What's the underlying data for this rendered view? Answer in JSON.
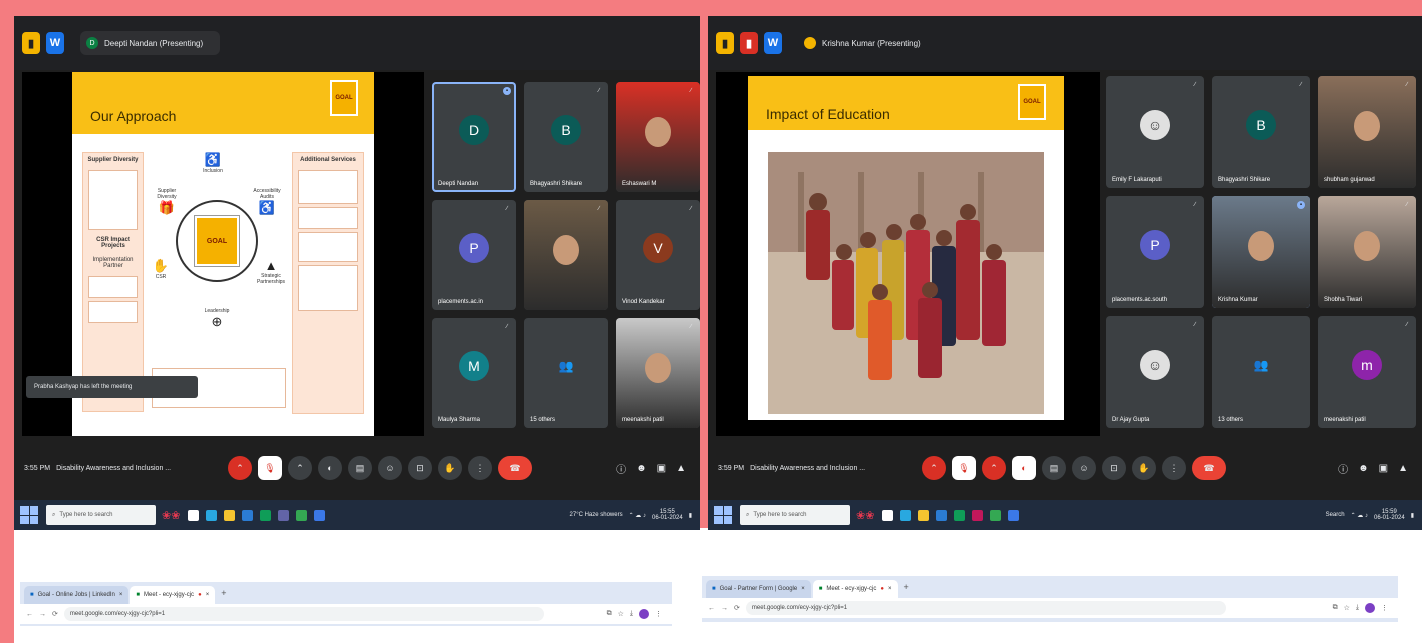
{
  "colors": {
    "background": "#f47c80",
    "meet_dark": "#202124",
    "tile_bg": "#3c4043",
    "slide_header": "#f9bf16",
    "end_call": "#ea4335",
    "taskbar": "#202c3e"
  },
  "left": {
    "presenter_initial": "D",
    "presenter_label": "Deepti Nandan (Presenting)",
    "slide": {
      "title": "Our Approach",
      "logo": "GOAL",
      "left_column_head": "Supplier Diversity",
      "left_column_sub": "CSR Impact Projects",
      "left_column_sub2": "Implementation Partner",
      "right_column_head": "Additional Services",
      "center_label": "GOAL",
      "nodes": [
        {
          "label": "Inclusion"
        },
        {
          "label": "Supplier Diversity"
        },
        {
          "label": "Accessibility Audits"
        },
        {
          "label": "CSR"
        },
        {
          "label": "Strategic Partnerships"
        },
        {
          "label": "Leadership"
        }
      ]
    },
    "toast": "Prabha Kashyap has left the meeting",
    "tiles": [
      {
        "initial": "D",
        "name": "Deepti Nandan",
        "color": "#0b5b57",
        "mic": "active"
      },
      {
        "initial": "B",
        "name": "Bhagyashri Shikare",
        "color": "#0b5b57",
        "mic": "muted"
      },
      {
        "initial": "",
        "name": "Eshaswari M",
        "color": "#d93025",
        "mic": "muted"
      },
      {
        "initial": "P",
        "name": "placements.ac.in",
        "color": "#5b5fc7",
        "mic": "muted"
      },
      {
        "initial": "",
        "name": "",
        "color": "#6b5a46",
        "mic": "muted"
      },
      {
        "initial": "V",
        "name": "Vinod Kandekar",
        "color": "#8b3a1e",
        "mic": "muted"
      },
      {
        "initial": "M",
        "name": "Maulya Sharma",
        "color": "#12808a",
        "mic": "muted"
      },
      {
        "initial": "",
        "name": "15 others",
        "color": "#3c4043",
        "mic": ""
      },
      {
        "initial": "",
        "name": "meenakshi patil",
        "color": "#c9c9c9",
        "mic": "muted"
      }
    ],
    "time": "3:55 PM",
    "meeting_title": "Disability Awareness and Inclusion ..."
  },
  "right": {
    "presenter_label": "Krishna Kumar (Presenting)",
    "slide": {
      "title": "Impact of Education",
      "logo": "GOAL"
    },
    "tiles": [
      {
        "initial": "",
        "name": "Emily F Lakaraputi",
        "color": "#3c4043",
        "mic": "muted"
      },
      {
        "initial": "B",
        "name": "Bhagyashri Shikare",
        "color": "#0b5b57",
        "mic": "muted"
      },
      {
        "initial": "",
        "name": "shubham gujarwad",
        "color": "#8a6f5a",
        "mic": "muted"
      },
      {
        "initial": "P",
        "name": "placements.ac.south",
        "color": "#5b5fc7",
        "mic": "muted"
      },
      {
        "initial": "",
        "name": "Krishna Kumar",
        "color": "#6b7a8a",
        "mic": "active"
      },
      {
        "initial": "",
        "name": "Shobha Tiwari",
        "color": "#b9a79a",
        "mic": "muted"
      },
      {
        "initial": "",
        "name": "Dr Ajay Gupta",
        "color": "#3c4043",
        "mic": "muted"
      },
      {
        "initial": "",
        "name": "13 others",
        "color": "#3c4043",
        "mic": ""
      },
      {
        "initial": "m",
        "name": "meenakshi patil",
        "color": "#8e24aa",
        "mic": "muted"
      }
    ],
    "time": "3:59 PM",
    "meeting_title": "Disability Awareness and Inclusion ..."
  },
  "taskbar": {
    "search_placeholder": "Type here to search",
    "left_tray": "27°C Haze showers",
    "clock_time": "15:55",
    "clock_date": "06-01-2024",
    "right_tray": "Search",
    "right_clock_time": "15:59",
    "right_clock_date": "06-01-2024"
  },
  "browser_left": {
    "tabs": [
      {
        "label": "Goal - Online Jobs | LinkedIn"
      },
      {
        "label": "Meet - ecy-xjgy-cjc"
      }
    ],
    "url": "meet.google.com/ecy-xjgy-cjc?pli=1"
  },
  "browser_right": {
    "tabs": [
      {
        "label": "Goal - Partner Form | Google"
      },
      {
        "label": "Meet - ecy-xjgy-cjc"
      }
    ],
    "url": "meet.google.com/ecy-xjgy-cjc?pli=1"
  }
}
